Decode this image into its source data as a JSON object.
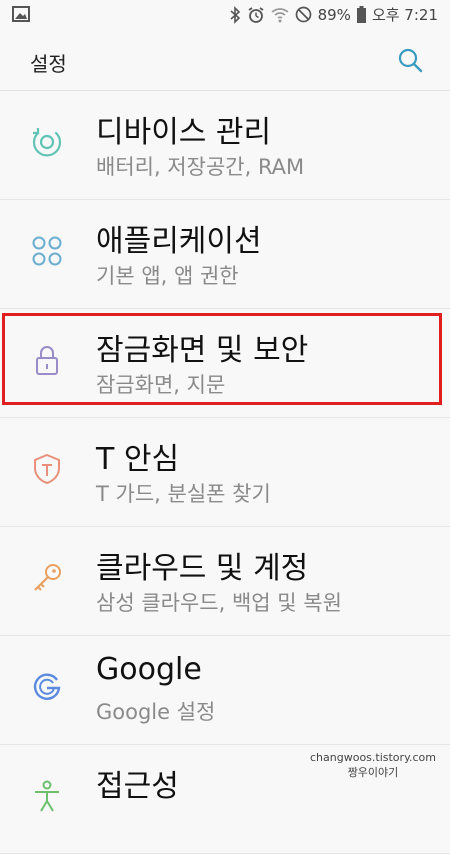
{
  "status_bar": {
    "battery": "89%",
    "time": "오후 7:21"
  },
  "app_bar": {
    "title": "설정"
  },
  "items": [
    {
      "title": "디바이스 관리",
      "subtitle": "배터리, 저장공간, RAM",
      "icon": "device-care-icon",
      "color": "#5fc4b4"
    },
    {
      "title": "애플리케이션",
      "subtitle": "기본 앱, 앱 권한",
      "icon": "apps-grid-icon",
      "color": "#6aaed0"
    },
    {
      "title": "잠금화면 및 보안",
      "subtitle": "잠금화면, 지문",
      "icon": "lock-icon",
      "color": "#9a8cc8"
    },
    {
      "title": "T 안심",
      "subtitle": "T 가드, 분실폰 찾기",
      "icon": "shield-icon",
      "color": "#e8907a"
    },
    {
      "title": "클라우드 및 계정",
      "subtitle": "삼성 클라우드, 백업 및 복원",
      "icon": "key-icon",
      "color": "#e8a060"
    },
    {
      "title": "Google",
      "subtitle": "Google 설정",
      "icon": "google-icon",
      "color": "#5b8ae0"
    },
    {
      "title": "접근성",
      "subtitle": "",
      "icon": "accessibility-icon",
      "color": "#6cc06c"
    }
  ],
  "watermark": {
    "line1": "changwoos.tistory.com",
    "line2": "짱우이야기"
  }
}
